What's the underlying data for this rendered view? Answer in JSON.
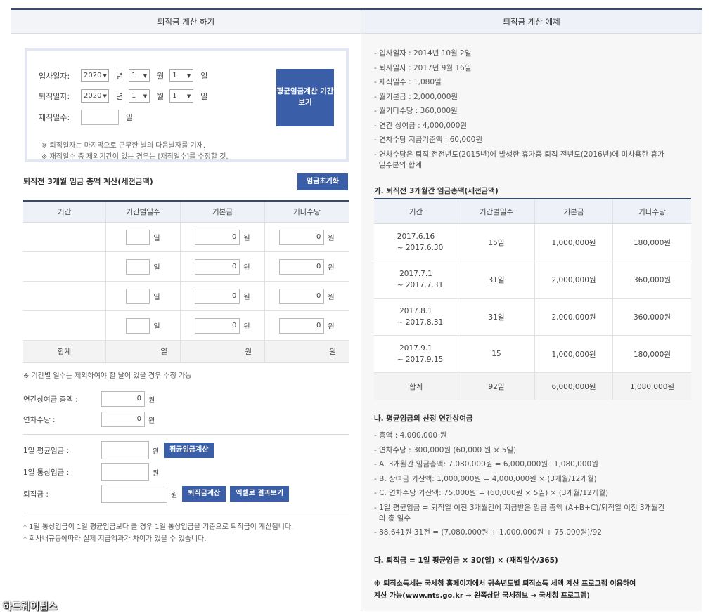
{
  "left": {
    "title": "퇴직금 계산 하기",
    "hire_date": {
      "label": "입사일자:",
      "year": "2020",
      "month": "1",
      "day": "1"
    },
    "retire_date": {
      "label": "퇴직일자:",
      "year": "2020",
      "month": "1",
      "day": "1"
    },
    "units": {
      "year": "년",
      "month": "월",
      "day": "일",
      "won": "원"
    },
    "tenure": {
      "label": "재직일수:",
      "value": "",
      "unit": "일"
    },
    "period_button": "평균임금계산 기간보기",
    "notes": [
      "※ 퇴직일자는 마지막으로 근무한 날의 다음날자를 기재.",
      "※ 재직일수 중 제외기간이 있는 경우는 [재직일수]를 수정할 것."
    ],
    "wage_section_title": "퇴직전 3개월 임금 총액 계산(세전금액)",
    "reset_button": "임금초기화",
    "table": {
      "headers": [
        "기간",
        "기간별일수",
        "기본금",
        "기타수당"
      ],
      "rows": [
        {
          "days": "",
          "base": "0",
          "extra": "0"
        },
        {
          "days": "",
          "base": "0",
          "extra": "0"
        },
        {
          "days": "",
          "base": "0",
          "extra": "0"
        },
        {
          "days": "",
          "base": "0",
          "extra": "0"
        }
      ],
      "sum_label": "합계"
    },
    "days_note": "※ 기간별 일수는 제외하여야 할 날이 있을 경우 수정 가능",
    "annual_bonus": {
      "label": "연간상여금 총액 :",
      "value": "0"
    },
    "leave_pay": {
      "label": "연차수당 :",
      "value": "0"
    },
    "daily_avg": {
      "label": "1일 평균임금 :",
      "value": ""
    },
    "avg_calc_button": "평균임금계산",
    "daily_normal": {
      "label": "1일 통상임금 :",
      "value": ""
    },
    "severance": {
      "label": "퇴직금 :",
      "value": ""
    },
    "severance_calc_button": "퇴직금계산",
    "excel_button": "엑셀로 결과보기",
    "footnotes": [
      "* 1일 통상임금이 1일 평균임금보다 클 경우 1일 통상임금을 기준으로 퇴직금이 계산됩니다.",
      "* 회사내규등에따라 실제 지급액과가 차이가 있을 수 있습니다."
    ]
  },
  "right": {
    "title": "퇴직금 계산 예제",
    "facts": [
      "- 입사일자 : 2014년 10월 2일",
      "- 퇴사일자 : 2017년 9월 16일",
      "- 재직일수 : 1,080일",
      "- 월기본급 : 2,000,000원",
      "- 월기타수당 : 360,000원",
      "- 연간 상여금 : 4,000,000원",
      "- 연차수당 지급기준액 : 60,000원",
      "- 연차수당은 퇴직 전전년도(2015년)에 발생한 휴가중 퇴직 전년도(2016년)에 미사용한 휴가",
      "  일수분의 합계"
    ],
    "section_a_title": "가. 퇴직전 3개월간 임금총액(세전금액)",
    "table": {
      "headers": [
        "기간",
        "기간별일수",
        "기본금",
        "기타수당"
      ],
      "rows": [
        {
          "from": "2017.6.16",
          "to": "~ 2017.6.30",
          "days": "15일",
          "base": "1,000,000원",
          "extra": "180,000원"
        },
        {
          "from": "2017.7.1",
          "to": "~ 2017.7.31",
          "days": "31일",
          "base": "2,000,000원",
          "extra": "360,000원"
        },
        {
          "from": "2017.8.1",
          "to": "~ 2017.8.31",
          "days": "31일",
          "base": "2,000,000원",
          "extra": "360,000원"
        },
        {
          "from": "2017.9.1",
          "to": "~ 2017.9.15",
          "days": "15",
          "base": "1,000,000원",
          "extra": "180,000원"
        }
      ],
      "sum": {
        "label": "합계",
        "days": "92일",
        "base": "6,000,000원",
        "extra": "1,080,000원"
      }
    },
    "section_b_title": "나. 평균임금의 산정 연간상여금",
    "calc": [
      "- 총액 : 4,000,000 원",
      "- 연차수당 : 300,000원 (60,000 원 × 5일)",
      "- A. 3개월간 임금총액: 7,080,000원 = 6,000,000원+1,080,000원",
      "- B. 상여금 가산액: 1,000,000원 = 4,000,000원 × (3개월/12개월)",
      "- C. 연차수당 가산액: 75,000원 = (60,000원 × 5일) × (3개월/12개월)",
      "- 1일 평균임금 = 퇴직일 이전 3개월간에 지급받은 임금 총액 (A+B+C)/퇴직일 이전 3개월간",
      "  의 총 일수",
      "- 88,641원 31전 = (7,080,000원 + 1,000,000원 + 75,000원)/92"
    ],
    "section_c": "다. 퇴직금 = 1일 평균임금 × 30(일) × (재직일수/365)",
    "tax_note_1": "※ 퇴직소득세는 국세청 홈페이지에서 귀속년도별 퇴직소득 세액 계산 프로그램 이용하여",
    "tax_note_2": "계산 가능(www.nts.go.kr → 왼쪽상단 국세정보 → 국세청 프로그램)"
  },
  "watermark": "하드웨어팁스"
}
